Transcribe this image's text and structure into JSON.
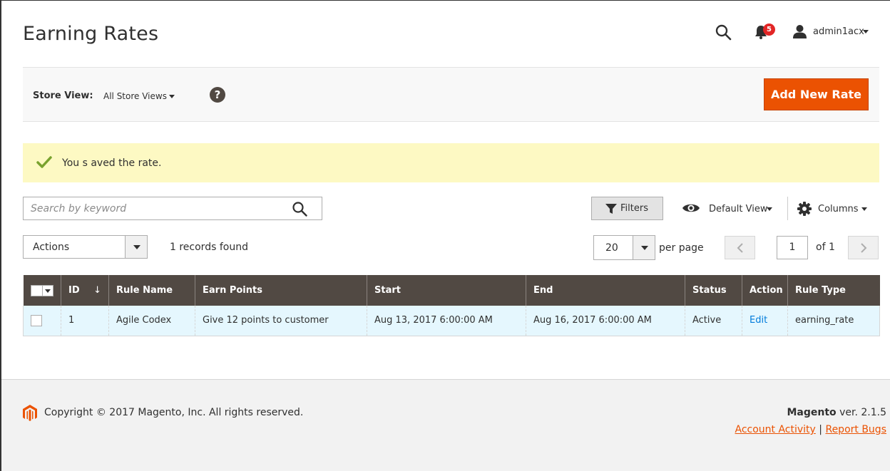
{
  "header": {
    "title": "Earning Rates",
    "notifications_count": "5",
    "user_name": "admin1acx"
  },
  "store_bar": {
    "label": "Store View:",
    "value": "All Store Views",
    "help": "?",
    "add_button": "Add New Rate"
  },
  "message": {
    "text": "You s aved the rate."
  },
  "toolbar": {
    "search_placeholder": "Search by keyword",
    "filters_label": "Filters",
    "view_label": "Default View",
    "columns_label": "Columns",
    "actions_label": "Actions",
    "records_found": "1 records found",
    "per_page_value": "20",
    "per_page_label": "per page",
    "current_page": "1",
    "of_pages": "of 1"
  },
  "grid": {
    "columns": [
      "ID",
      "Rule Name",
      "Earn Points",
      "Start",
      "End",
      "Status",
      "Action",
      "Rule Type"
    ],
    "sort_arrow": "↓",
    "rows": [
      {
        "id": "1",
        "rule_name": "Agile Codex",
        "earn_points": "Give 12 points to customer",
        "start": "Aug 13, 2017 6:00:00 AM",
        "end": "Aug 16, 2017 6:00:00 AM",
        "status": "Active",
        "action": "Edit",
        "rule_type": "earning_rate"
      }
    ]
  },
  "footer": {
    "copyright": "Copyright © 2017 Magento, Inc. All rights reserved.",
    "brand": "Magento",
    "version": " ver. 2.1.5",
    "account_activity": "Account Activity",
    "separator": " | ",
    "report_bugs": "Report Bugs"
  },
  "colors": {
    "accent": "#eb5202",
    "grid_header": "#514943",
    "row_highlight": "#e5f7fe",
    "message_bg": "#fdf9c3",
    "success_check": "#79a22e",
    "badge": "#e22626",
    "link": "#007bdb"
  },
  "icons": [
    "search-icon",
    "bell-icon",
    "user-icon",
    "help-icon",
    "check-icon",
    "funnel-icon",
    "eye-icon",
    "gear-icon",
    "chevron-left-icon",
    "chevron-right-icon",
    "magento-logo-icon"
  ]
}
